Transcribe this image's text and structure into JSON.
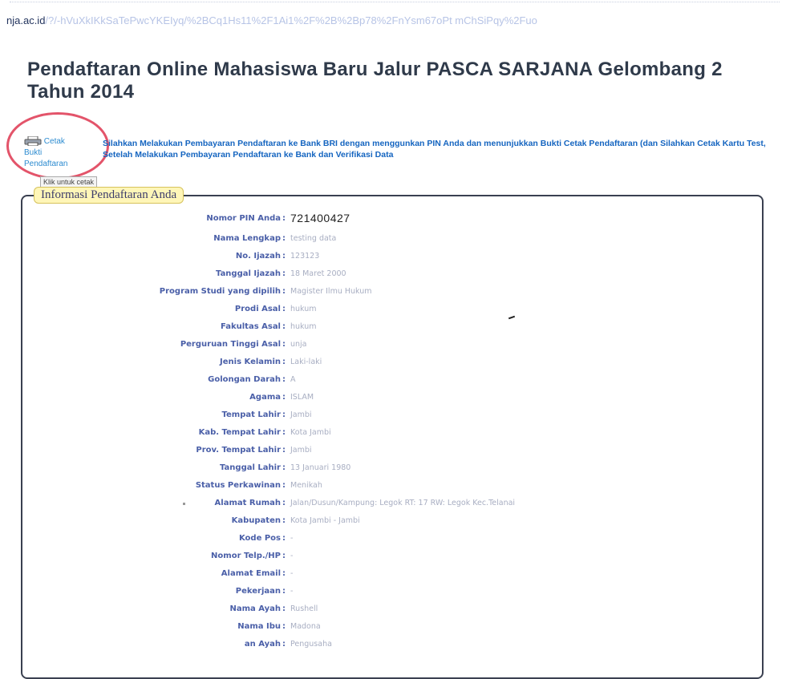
{
  "browser": {
    "url_host": "nja.ac.id",
    "url_path": "/?/-hVuXkIKkSaTePwcYKEIyq/%2BCq1Hs11%2F1Ai1%2F%2B%2Bp78%2FnYsm67oPt mChSiPqy%2Fuo"
  },
  "page": {
    "title": "Pendaftaran Online Mahasiswa Baru Jalur PASCA SARJANA Gelombang 2 Tahun 2014"
  },
  "print_link": {
    "icon": "printer-icon",
    "label_1": "Cetak",
    "label_2": "Bukti",
    "label_3": "Pendaftaran",
    "tooltip": "Klik untuk cetak"
  },
  "notice": {
    "text": "Silahkan Melakukan Pembayaran Pendaftaran ke Bank BRI dengan menggunkan PIN Anda dan menunjukkan Bukti Cetak Pendaftaran (dan Silahkan Cetak Kartu Test, Setelah Melakukan Pembayaran Pendaftaran ke Bank dan Verifikasi Data"
  },
  "info": {
    "legend": "Informasi Pendaftaran Anda",
    "fields": [
      {
        "label": "Nomor PIN Anda",
        "value": "721400427"
      },
      {
        "label": "Nama Lengkap",
        "value": "testing data"
      },
      {
        "label": "No. Ijazah",
        "value": "123123"
      },
      {
        "label": "Tanggal Ijazah",
        "value": "18 Maret 2000"
      },
      {
        "label": "Program Studi yang dipilih",
        "value": "Magister Ilmu Hukum"
      },
      {
        "label": "Prodi Asal",
        "value": "hukum"
      },
      {
        "label": "Fakultas Asal",
        "value": "hukum"
      },
      {
        "label": "Perguruan Tinggi Asal",
        "value": "unja"
      },
      {
        "label": "Jenis Kelamin",
        "value": "Laki-laki"
      },
      {
        "label": "Golongan Darah",
        "value": "A"
      },
      {
        "label": "Agama",
        "value": "ISLAM"
      },
      {
        "label": "Tempat Lahir",
        "value": "Jambi"
      },
      {
        "label": "Kab. Tempat Lahir",
        "value": "Kota Jambi"
      },
      {
        "label": "Prov. Tempat Lahir",
        "value": "Jambi"
      },
      {
        "label": "Tanggal Lahir",
        "value": "13 Januari 1980"
      },
      {
        "label": "Status Perkawinan",
        "value": "Menikah"
      },
      {
        "label": "Alamat Rumah",
        "value": "Jalan/Dusun/Kampung: Legok RT: 17 RW: Legok Kec.Telanai"
      },
      {
        "label": "Kabupaten",
        "value": "Kota Jambi - Jambi"
      },
      {
        "label": "Kode Pos",
        "value": "-"
      },
      {
        "label": "Nomor Telp./HP",
        "value": "-"
      },
      {
        "label": "Alamat Email",
        "value": "-"
      },
      {
        "label": "Pekerjaan",
        "value": "-"
      },
      {
        "label": "Nama Ayah",
        "value": "Rushell"
      },
      {
        "label": "Nama Ibu",
        "value": "Madona"
      },
      {
        "label": "an Ayah",
        "value": "Pengusaha"
      }
    ]
  }
}
